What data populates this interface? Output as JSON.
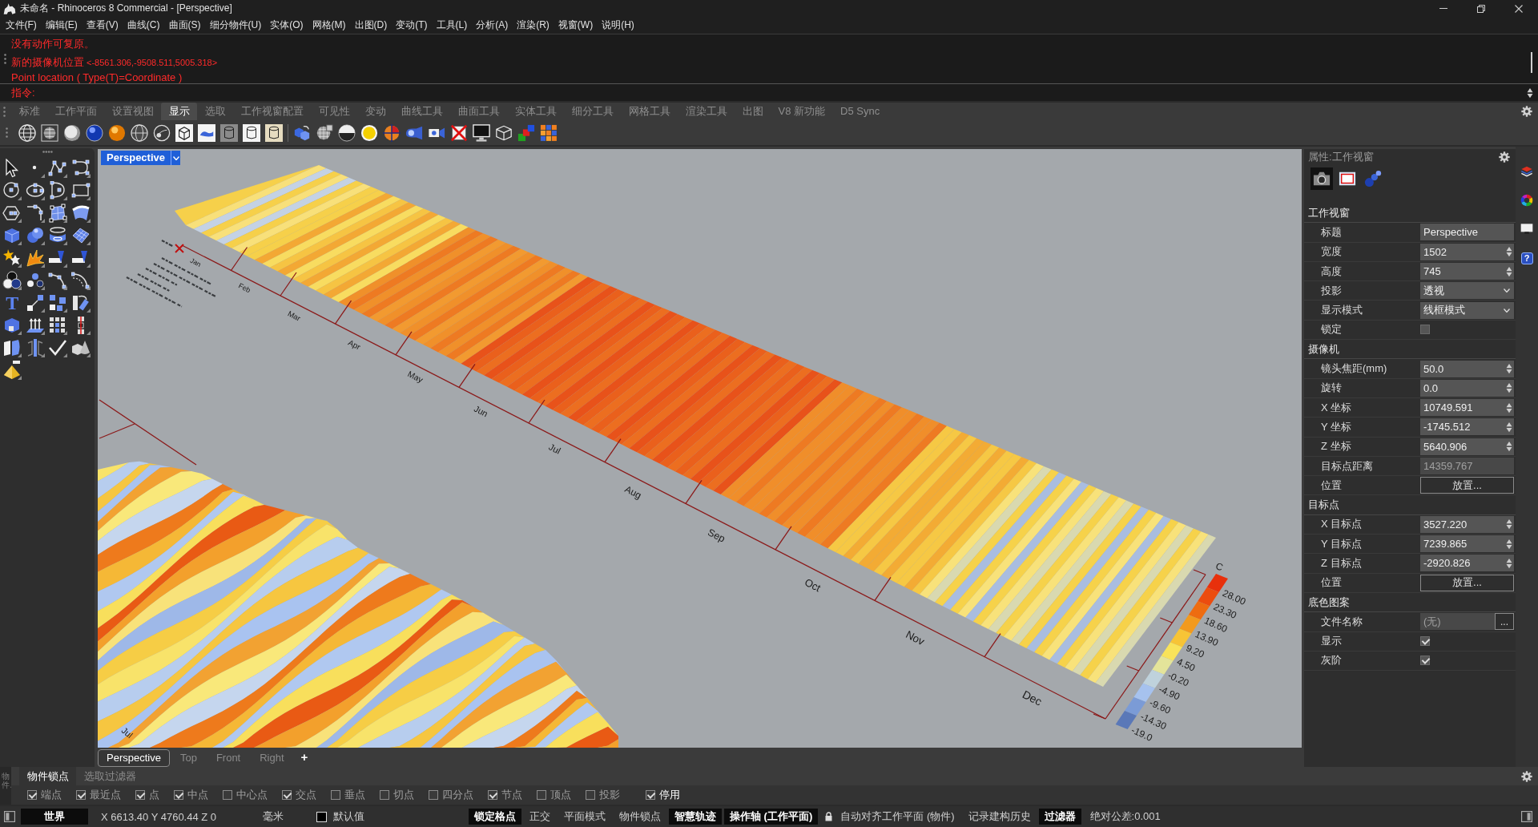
{
  "window": {
    "title": "未命名 - Rhinoceros 8 Commercial - [Perspective]"
  },
  "menu": [
    "文件(F)",
    "编辑(E)",
    "查看(V)",
    "曲线(C)",
    "曲面(S)",
    "细分物件(U)",
    "实体(O)",
    "网格(M)",
    "出图(D)",
    "变动(T)",
    "工具(L)",
    "分析(A)",
    "渲染(R)",
    "视窗(W)",
    "说明(H)"
  ],
  "command_history": [
    {
      "text": "没有动作可复原。"
    },
    {
      "text": "新的摄像机位置",
      "detail": "<-8561.306,-9508.511,5005.318>"
    },
    {
      "text": "Point location ( Type(T)=Coordinate )"
    }
  ],
  "command_prompt": "指令:",
  "toolbar_tabs": [
    {
      "label": "标准",
      "selected": false
    },
    {
      "label": "工作平面",
      "selected": false
    },
    {
      "label": "设置视图",
      "selected": false
    },
    {
      "label": "显示",
      "selected": true
    },
    {
      "label": "选取",
      "selected": false
    },
    {
      "label": "工作视窗配置",
      "selected": false
    },
    {
      "label": "可见性",
      "selected": false
    },
    {
      "label": "变动",
      "selected": false
    },
    {
      "label": "曲线工具",
      "selected": false
    },
    {
      "label": "曲面工具",
      "selected": false
    },
    {
      "label": "实体工具",
      "selected": false
    },
    {
      "label": "细分工具",
      "selected": false
    },
    {
      "label": "网格工具",
      "selected": false
    },
    {
      "label": "渲染工具",
      "selected": false
    },
    {
      "label": "出图",
      "selected": false
    },
    {
      "label": "V8 新功能",
      "selected": false
    },
    {
      "label": "D5 Sync",
      "selected": false
    }
  ],
  "left_toolbar": {
    "text_tool_glyph": "T"
  },
  "viewport": {
    "title": "Perspective",
    "scene": {
      "month_labels": [
        "Jan",
        "Feb",
        "Mar",
        "Apr",
        "May",
        "Jun",
        "Jul",
        "Aug",
        "Sep",
        "Oct",
        "Nov",
        "Dec"
      ],
      "legend_unit": "C",
      "legend": [
        {
          "label": "28.00",
          "color": "#e8300c"
        },
        {
          "label": "23.30",
          "color": "#ec4c0e"
        },
        {
          "label": "18.60",
          "color": "#ee6c10"
        },
        {
          "label": "13.90",
          "color": "#f29a1e"
        },
        {
          "label": "9.20",
          "color": "#f7c436"
        },
        {
          "label": "4.50",
          "color": "#f9e35a"
        },
        {
          "label": "-0.20",
          "color": "#e4e49a"
        },
        {
          "label": "-4.90",
          "color": "#bfd2dc"
        },
        {
          "label": "-9.60",
          "color": "#a6c2ee"
        },
        {
          "label": "-14.30",
          "color": "#7b9bd6"
        },
        {
          "label": "-19.0",
          "color": "#5a78b8"
        }
      ],
      "lower_chart_labels": [
        "Jul"
      ]
    }
  },
  "viewport_tabs": [
    {
      "label": "Perspective",
      "selected": true
    },
    {
      "label": "Top",
      "selected": false
    },
    {
      "label": "Front",
      "selected": false
    },
    {
      "label": "Right",
      "selected": false
    }
  ],
  "add_viewport": "+",
  "properties": {
    "title": "属性:工作视窗",
    "pages": [
      {
        "selected": true
      },
      {
        "selected": false
      },
      {
        "selected": false
      }
    ],
    "sections": [
      {
        "title": "工作视窗",
        "rows": [
          {
            "label": "标题",
            "kind": "text",
            "value": "Perspective",
            "disabled": false
          },
          {
            "label": "宽度",
            "kind": "number",
            "value": "1502",
            "disabled": false
          },
          {
            "label": "高度",
            "kind": "number",
            "value": "745",
            "disabled": false
          },
          {
            "label": "投影",
            "kind": "dropdown",
            "value": "透视",
            "disabled": false
          },
          {
            "label": "显示模式",
            "kind": "dropdown",
            "value": "线框模式",
            "disabled": false
          },
          {
            "label": "锁定",
            "kind": "check",
            "checked": false,
            "disabled": false
          }
        ]
      },
      {
        "title": "摄像机",
        "rows": [
          {
            "label": "镜头焦距(mm)",
            "kind": "number",
            "value": "50.0",
            "disabled": false
          },
          {
            "label": "旋转",
            "kind": "number",
            "value": "0.0",
            "disabled": false
          },
          {
            "label": "X 坐标",
            "kind": "number",
            "value": "10749.591",
            "disabled": false
          },
          {
            "label": "Y 坐标",
            "kind": "number",
            "value": "-1745.512",
            "disabled": false
          },
          {
            "label": "Z 坐标",
            "kind": "number",
            "value": "5640.906",
            "disabled": false
          },
          {
            "label": "目标点距离",
            "kind": "text",
            "value": "14359.767",
            "disabled": true
          },
          {
            "label": "位置",
            "kind": "button",
            "value": "放置...",
            "disabled": false
          }
        ]
      },
      {
        "title": "目标点",
        "rows": [
          {
            "label": "X 目标点",
            "kind": "number",
            "value": "3527.220",
            "disabled": false
          },
          {
            "label": "Y 目标点",
            "kind": "number",
            "value": "7239.865",
            "disabled": false
          },
          {
            "label": "Z 目标点",
            "kind": "number",
            "value": "-2920.826",
            "disabled": false
          },
          {
            "label": "位置",
            "kind": "button",
            "value": "放置...",
            "disabled": false
          }
        ]
      },
      {
        "title": "底色图案",
        "rows": [
          {
            "label": "文件名称",
            "kind": "file",
            "value": "(无)",
            "button": "...",
            "disabled": true
          },
          {
            "label": "显示",
            "kind": "check",
            "checked": true,
            "disabled": false
          },
          {
            "label": "灰阶",
            "kind": "check",
            "checked": true,
            "disabled": false
          }
        ]
      }
    ]
  },
  "side_tabs": {
    "help_glyph": "?"
  },
  "osnap": {
    "side_label": "物件…",
    "tabs": [
      {
        "label": "物件锁点",
        "selected": true
      },
      {
        "label": "选取过滤器",
        "selected": false
      }
    ],
    "items": [
      {
        "label": "端点",
        "checked": true
      },
      {
        "label": "最近点",
        "checked": true
      },
      {
        "label": "点",
        "checked": true
      },
      {
        "label": "中点",
        "checked": true
      },
      {
        "label": "中心点",
        "checked": false
      },
      {
        "label": "交点",
        "checked": true
      },
      {
        "label": "垂点",
        "checked": false
      },
      {
        "label": "切点",
        "checked": false
      },
      {
        "label": "四分点",
        "checked": false
      },
      {
        "label": "节点",
        "checked": true
      },
      {
        "label": "顶点",
        "checked": false
      },
      {
        "label": "投影",
        "checked": false
      }
    ],
    "disable_all": {
      "label": "停用",
      "checked": true
    }
  },
  "status_bar": {
    "cplane": "世界",
    "coordinates": "X 6613.40 Y 4760.44 Z 0",
    "units": "毫米",
    "layer": {
      "name": "默认值",
      "color": "#000000"
    },
    "panes": [
      {
        "label": "锁定格点",
        "on": true,
        "kind": "toggle"
      },
      {
        "label": "正交",
        "on": false,
        "kind": "toggle"
      },
      {
        "label": "平面模式",
        "on": false,
        "kind": "toggle"
      },
      {
        "label": "物件锁点",
        "on": false,
        "kind": "toggle"
      },
      {
        "label": "智慧轨迹",
        "on": true,
        "kind": "toggle"
      },
      {
        "label": "操作轴 (工作平面)",
        "on": true,
        "kind": "toggle"
      },
      {
        "label": "自动对齐工作平面 (物件)",
        "on": false,
        "kind": "locked"
      },
      {
        "label": "记录建构历史",
        "on": false,
        "kind": "toggle"
      },
      {
        "label": "过滤器",
        "on": true,
        "kind": "toggle"
      }
    ],
    "tolerance": "绝对公差:0.001"
  }
}
